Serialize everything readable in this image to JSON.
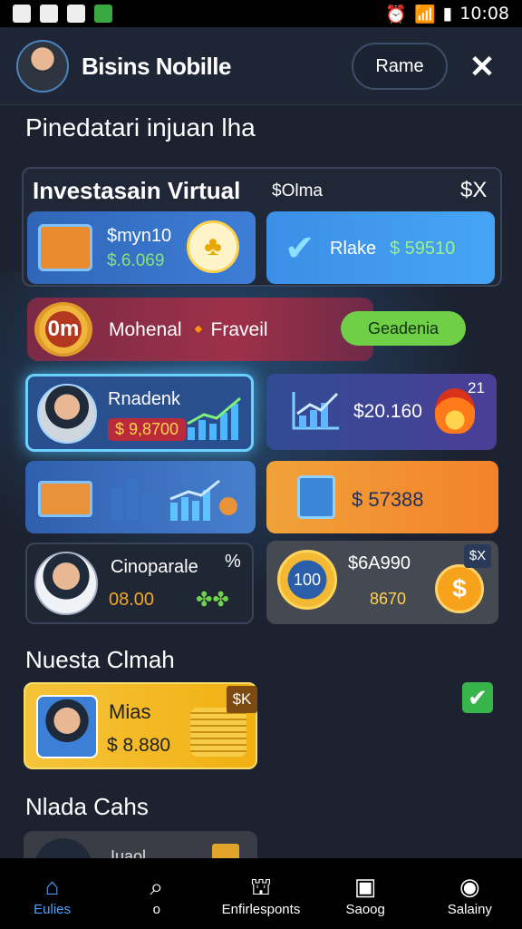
{
  "status_bar": {
    "time": "10:08"
  },
  "header": {
    "title": "Bisins Nobille",
    "button_label": "Rame",
    "menu_icon": "x-close-icon"
  },
  "section1_title": "Pinedatari injuan lha",
  "virtual_panel": {
    "title": "Investasain Virtual",
    "subtitle": "$Olma",
    "right_label": "$X",
    "card1": {
      "label": "$myn10",
      "value": "$.6.069"
    },
    "card2": {
      "label": "Rlake",
      "value": "$ 59510"
    }
  },
  "banner": {
    "badge": "0m",
    "title": "Mohenal 🔸Fraveil",
    "button_label": "Geadenia"
  },
  "tiles": {
    "row3_left": {
      "name": "Rnadenk",
      "value": "$ 9,8700"
    },
    "row3_right": {
      "amount": "$20.160",
      "badge": "21"
    },
    "row4_right": {
      "amount": "$ 57388"
    },
    "row5_left": {
      "name": "Cinoparale",
      "value": "08.00",
      "x_label": "%"
    },
    "row5_right": {
      "amount": "$6A990",
      "value": "8670",
      "coin_label": "100",
      "badge": "$X"
    }
  },
  "section2_title": "Nuesta Clmah",
  "gold_card": {
    "name": "Mias",
    "value": "$ 8.880",
    "tag": "$K"
  },
  "section3_title": "Nlada Cahs",
  "peek_card": {
    "label": "Iuaol"
  },
  "nav": [
    {
      "label": "Eulies",
      "icon": "home-icon",
      "active": true
    },
    {
      "label": "o",
      "icon": "search-icon",
      "active": false
    },
    {
      "label": "Enfirlesponts",
      "icon": "market-icon",
      "active": false
    },
    {
      "label": "Saoog",
      "icon": "chart-icon",
      "active": false
    },
    {
      "label": "Salainy",
      "icon": "profile-icon",
      "active": false
    }
  ],
  "colors": {
    "background": "#1c2230",
    "accent_green": "#6fd047",
    "accent_blue": "#4aa3ff",
    "gold": "#f5c43a"
  }
}
